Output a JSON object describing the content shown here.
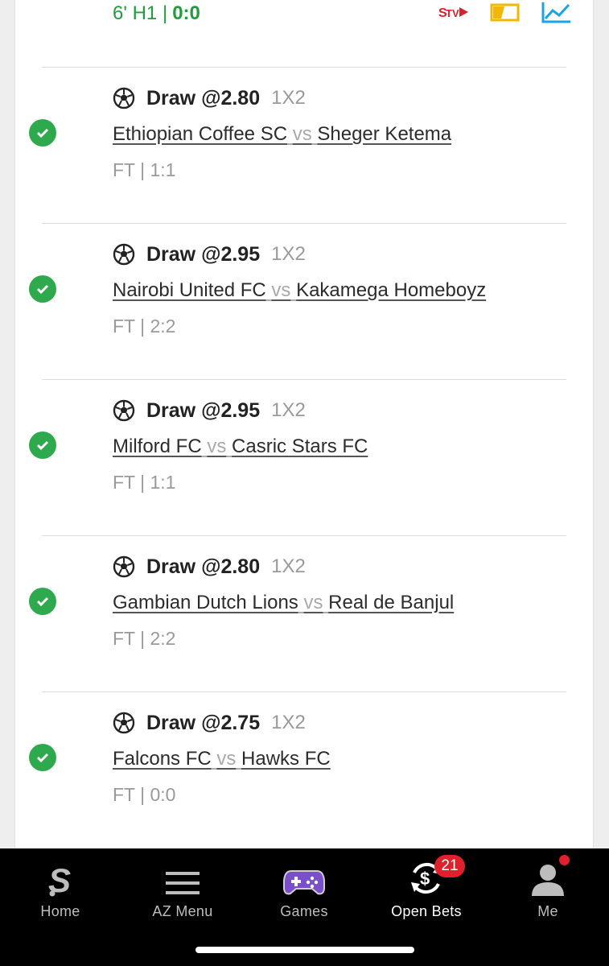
{
  "live": {
    "minute_half": "6' H1 |",
    "score": "0:0"
  },
  "bets": [
    {
      "pick": "Draw @2.80",
      "market": "1X2",
      "home": "Ethiopian Coffee SC",
      "vs": "vs",
      "away": "Sheger Ketema",
      "result": "FT | 1:1",
      "status": "won"
    },
    {
      "pick": "Draw @2.95",
      "market": "1X2",
      "home": "Nairobi United FC",
      "vs": "vs",
      "away": "Kakamega Homeboyz",
      "result": "FT | 2:2",
      "status": "won"
    },
    {
      "pick": "Draw @2.95",
      "market": "1X2",
      "home": "Milford FC",
      "vs": "vs",
      "away": "Casric Stars FC",
      "result": "FT | 1:1",
      "status": "won"
    },
    {
      "pick": "Draw @2.80",
      "market": "1X2",
      "home": "Gambian Dutch Lions",
      "vs": "vs",
      "away": "Real de Banjul",
      "result": "FT | 2:2",
      "status": "won"
    },
    {
      "pick": "Draw @2.75",
      "market": "1X2",
      "home": "Falcons FC",
      "vs": "vs",
      "away": "Hawks FC",
      "result": "FT | 0:0",
      "status": "won"
    }
  ],
  "nav": {
    "home": "Home",
    "az_menu": "AZ Menu",
    "games": "Games",
    "open_bets": "Open Bets",
    "open_bets_badge": "21",
    "me": "Me"
  },
  "colors": {
    "live_green": "#1f9e3b",
    "check_green": "#2fa94e",
    "badge_red": "#e0202a",
    "games_purple": "#7b4fc9"
  },
  "icons": [
    "stv-icon",
    "match-tracker-icon",
    "stats-chart-icon",
    "soccer-ball-icon",
    "check-circle-icon",
    "home-s-icon",
    "menu-icon",
    "gamepad-icon",
    "open-bets-icon",
    "user-icon"
  ]
}
